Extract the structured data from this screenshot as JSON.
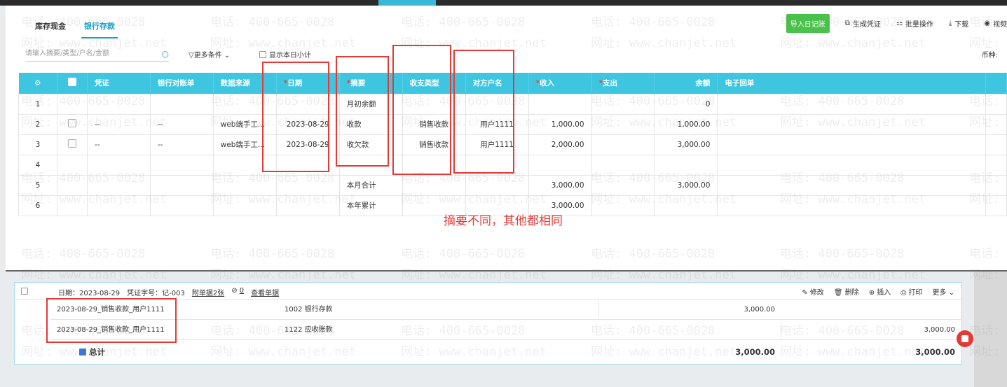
{
  "tabs": [
    "库存现金",
    "银行存款"
  ],
  "actions": {
    "import": "导入日记账",
    "gen_voucher": "生成凭证",
    "batch": "批量操作",
    "download": "下载",
    "video": "视频"
  },
  "filter": {
    "search_placeholder": "请输入摘要/类型/户名/金额",
    "more_conditions": "更多条件",
    "show_daily_subtotal": "显示本日小计",
    "currency_label": "币种:"
  },
  "table": {
    "headers": [
      "凭证",
      "银行对账单",
      "数据来源",
      "日期",
      "摘要",
      "收支类型",
      "对方户名",
      "收入",
      "支出",
      "余额",
      "电子回单"
    ],
    "required_headers": [
      "日期",
      "摘要",
      "收入",
      "支出"
    ],
    "rows": [
      {
        "no": "1",
        "voucher": "",
        "stmt": "",
        "source": "",
        "date": "",
        "summary": "月初余额",
        "type": "",
        "party": "",
        "income": "",
        "expense": "",
        "balance": "0",
        "checkbox": false
      },
      {
        "no": "2",
        "voucher": "--",
        "stmt": "--",
        "source": "web端手工...",
        "date": "2023-08-29",
        "summary": "收款",
        "type": "销售收款",
        "party": "用户1111",
        "income": "1,000.00",
        "expense": "",
        "balance": "1,000.00",
        "checkbox": true
      },
      {
        "no": "3",
        "voucher": "--",
        "stmt": "--",
        "source": "web端手工...",
        "date": "2023-08-29",
        "summary": "收欠款",
        "type": "销售收款",
        "party": "用户1111",
        "income": "2,000.00",
        "expense": "",
        "balance": "3,000.00",
        "checkbox": true
      },
      {
        "no": "4",
        "voucher": "",
        "stmt": "",
        "source": "",
        "date": "",
        "summary": "",
        "type": "",
        "party": "",
        "income": "",
        "expense": "",
        "balance": "",
        "checkbox": false
      },
      {
        "no": "5",
        "voucher": "",
        "stmt": "",
        "source": "",
        "date": "",
        "summary": "本月合计",
        "type": "",
        "party": "",
        "income": "3,000.00",
        "expense": "",
        "balance": "3,000.00",
        "checkbox": false
      },
      {
        "no": "6",
        "voucher": "",
        "stmt": "",
        "source": "",
        "date": "",
        "summary": "本年累计",
        "type": "",
        "party": "",
        "income": "3,000.00",
        "expense": "",
        "balance": "",
        "checkbox": false
      }
    ]
  },
  "annotation": "摘要不同，其他都相同",
  "voucher": {
    "date_label": "日期：2023-08-29",
    "number_label": "凭证字号：记-003",
    "attachments": "附单据2张",
    "link_count": "0",
    "view_doc": "查看单据",
    "ops": [
      "修改",
      "删除",
      "插入",
      "打印",
      "更多"
    ],
    "lines": [
      {
        "summary": "2023-08-29_销售收款_用户1111",
        "account": "1002 银行存款",
        "debit": "3,000.00",
        "credit": ""
      },
      {
        "summary": "2023-08-29_销售收款_用户1111",
        "account": "1122 应收账款",
        "debit": "",
        "credit": "3,000.00"
      }
    ],
    "total_label": "总计",
    "total_debit": "3,000.00",
    "total_credit": "3,000.00"
  },
  "watermark": {
    "phone": "电话: 400-665-0028",
    "site": "网址: www.chanjet.net"
  },
  "colors": {
    "header_bg": "#3ec6e0",
    "accent": "#14a0c8",
    "green_button": "#49c24a",
    "annotation_red": "#e53935"
  }
}
